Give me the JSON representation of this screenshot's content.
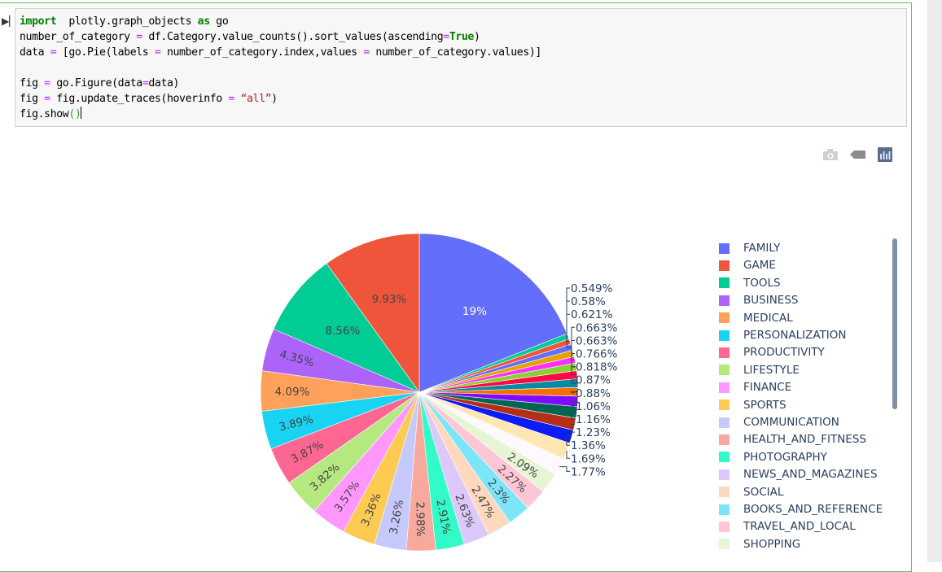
{
  "notebook": {
    "code_lines": [
      [
        [
          "kw",
          "import"
        ],
        [
          "",
          "  plotly.graph_objects "
        ],
        [
          "kw",
          "as"
        ],
        [
          "",
          " go"
        ]
      ],
      [
        [
          "",
          "number_of_category "
        ],
        [
          "op",
          "="
        ],
        [
          "",
          " df.Category.value_counts().sort_values(ascending"
        ],
        [
          "op",
          "="
        ],
        [
          "kw",
          "True"
        ],
        [
          "",
          ")"
        ]
      ],
      [
        [
          "",
          "data "
        ],
        [
          "op",
          "="
        ],
        [
          "",
          " [go.Pie(labels "
        ],
        [
          "op",
          "="
        ],
        [
          "",
          " number_of_category.index,values "
        ],
        [
          "op",
          "="
        ],
        [
          "",
          " number_of_category.values)]"
        ]
      ],
      [],
      [
        [
          "",
          "fig "
        ],
        [
          "op",
          "="
        ],
        [
          "",
          " go.Figure(data"
        ],
        [
          "op",
          "="
        ],
        [
          "",
          "data)"
        ]
      ],
      [
        [
          "",
          "fig "
        ],
        [
          "op",
          "="
        ],
        [
          "",
          " fig.update_traces(hoverinfo "
        ],
        [
          "op",
          "="
        ],
        [
          "",
          " "
        ],
        [
          "str",
          "“all”"
        ],
        [
          "",
          ")"
        ]
      ],
      [
        [
          "",
          "fig.show"
        ],
        [
          "par",
          "()"
        ]
      ]
    ]
  },
  "modebar": {
    "icons": [
      "camera-icon",
      "tag-icon",
      "plotly-logo-icon"
    ]
  },
  "chart_data": {
    "type": "pie",
    "labels": [
      "FAMILY",
      "GAME",
      "TOOLS",
      "BUSINESS",
      "MEDICAL",
      "PERSONALIZATION",
      "PRODUCTIVITY",
      "LIFESTYLE",
      "FINANCE",
      "SPORTS",
      "COMMUNICATION",
      "HEALTH_AND_FITNESS",
      "PHOTOGRAPHY",
      "NEWS_AND_MAGAZINES",
      "SOCIAL",
      "BOOKS_AND_REFERENCE",
      "TRAVEL_AND_LOCAL",
      "SHOPPING"
    ],
    "percent_labels": [
      "19%",
      "9.93%",
      "8.56%",
      "4.35%",
      "4.09%",
      "3.89%",
      "3.87%",
      "3.82%",
      "3.57%",
      "3.36%",
      "3.26%",
      "2.98%",
      "2.91%",
      "2.63%",
      "2.47%",
      "2.3%",
      "2.27%",
      "2.09%",
      "1.77%",
      "1.69%",
      "1.36%",
      "1.23%",
      "1.16%",
      "1.06%",
      "0.88%",
      "0.87%",
      "0.818%",
      "0.766%",
      "0.663%",
      "0.663%",
      "0.621%",
      "0.58%",
      "0.549%"
    ],
    "values": [
      19,
      9.93,
      8.56,
      4.35,
      4.09,
      3.89,
      3.87,
      3.82,
      3.57,
      3.36,
      3.26,
      2.98,
      2.91,
      2.63,
      2.47,
      2.3,
      2.27,
      2.09,
      1.77,
      1.69,
      1.36,
      1.23,
      1.16,
      1.06,
      0.88,
      0.87,
      0.818,
      0.766,
      0.663,
      0.663,
      0.621,
      0.58,
      0.549
    ],
    "colors": [
      "#636efa",
      "#ef553b",
      "#00cc96",
      "#ab63fa",
      "#ffa15a",
      "#19d3f3",
      "#ff6692",
      "#b6e880",
      "#ff97ff",
      "#fecb52",
      "#c6c9fb",
      "#f6a99c",
      "#33fbc8",
      "#dcc8fb",
      "#ffd8be",
      "#7ce5f7",
      "#ffc7d6",
      "#e6f6d4",
      "#fff8ff",
      "#ffe7b3",
      "#0d1bf5",
      "#b52e17",
      "#006651",
      "#7f0bff",
      "#f26f00",
      "#0a8aa0",
      "#ff0845",
      "#86d230",
      "#ff30ff",
      "#e3a300",
      "#636efa",
      "#ef553b",
      "#00cc96"
    ],
    "legend": "right",
    "direction": "counterclockwise",
    "sort": "descending"
  }
}
